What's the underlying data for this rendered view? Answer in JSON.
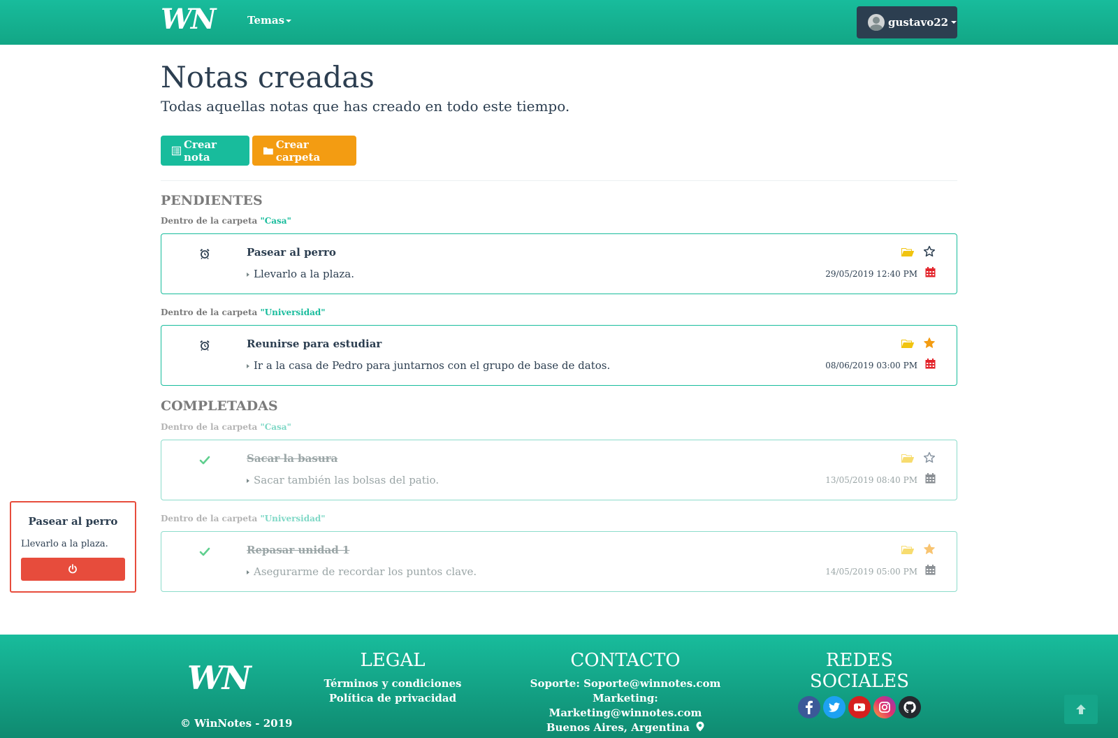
{
  "nav": {
    "logo_text": "WN",
    "temas_label": "Temas",
    "user_label": "gustavo22"
  },
  "page": {
    "title": "Notas creadas",
    "subtitle": "Todas aquellas notas que has creado en todo este tiempo."
  },
  "actions": {
    "create_note_label": "Crear nota",
    "create_folder_label": "Crear carpeta"
  },
  "sections": {
    "pending_title": "PENDIENTES",
    "completed_title": "COMPLETADAS",
    "folder_prefix": "Dentro de la carpeta"
  },
  "pending": [
    {
      "folder": "\"Casa\"",
      "title": "Pasear al perro",
      "description": "Llevarlo a la plaza.",
      "date": "29/05/2019 12:40 PM",
      "favorite": false
    },
    {
      "folder": "\"Universidad\"",
      "title": "Reunirse para estudiar",
      "description": "Ir a la casa de Pedro para juntarnos con el grupo de base de datos.",
      "date": "08/06/2019 03:00 PM",
      "favorite": true
    }
  ],
  "completed": [
    {
      "folder": "\"Casa\"",
      "title": "Sacar la basura",
      "description": "Sacar también las bolsas del patio.",
      "date": "13/05/2019 08:40 PM",
      "favorite": false
    },
    {
      "folder": "\"Universidad\"",
      "title": "Repasar unidad 1",
      "description": "Asegurarme de recordar los puntos clave.",
      "date": "14/05/2019 05:00 PM",
      "favorite": true
    }
  ],
  "popup": {
    "title": "Pasear al perro",
    "text": "Llevarlo a la plaza."
  },
  "footer": {
    "copyright": "© WinNotes - 2019",
    "legal_title": "LEGAL",
    "legal_links": [
      "Términos y condiciones",
      "Política de privacidad"
    ],
    "contact_title": "CONTACTO",
    "contact_lines": [
      "Soporte: Soporte@winnotes.com",
      "Marketing: Marketing@winnotes.com",
      "Buenos Aires, Argentina"
    ],
    "social_title": "REDES SOCIALES",
    "socials": [
      "facebook-icon",
      "twitter-icon",
      "youtube-icon",
      "instagram-icon",
      "github-icon"
    ]
  },
  "colors": {
    "brand": "#18bc9c",
    "navy": "#2c3e50",
    "orange": "#f39c12",
    "danger": "#e74c3c",
    "folder_yellow": "#f1c40f",
    "calendar_red": "#e3242b"
  }
}
